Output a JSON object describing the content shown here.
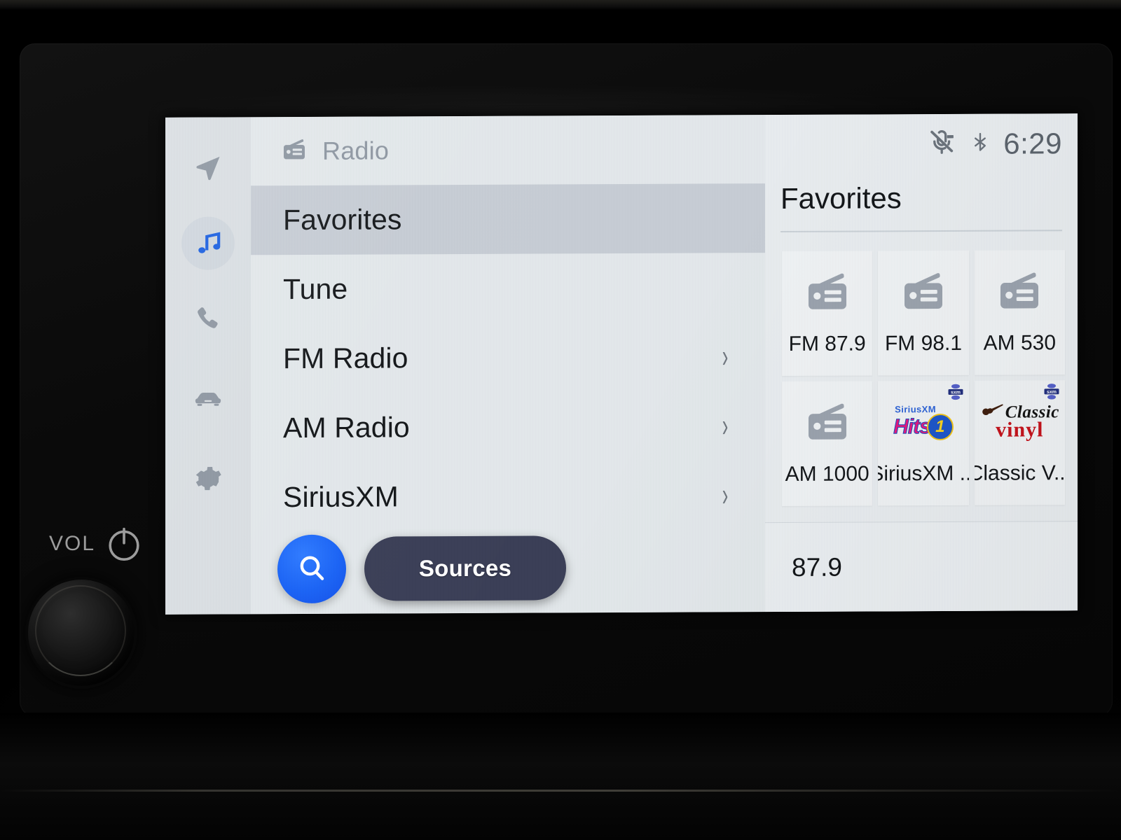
{
  "hardware": {
    "vol_label": "VOL",
    "power_icon": "power-icon",
    "knob": "volume-knob"
  },
  "sidebar": {
    "items": [
      {
        "icon": "navigation-arrow-icon",
        "name": "navigation",
        "active": false
      },
      {
        "icon": "music-note-icon",
        "name": "media",
        "active": true
      },
      {
        "icon": "phone-icon",
        "name": "phone",
        "active": false
      },
      {
        "icon": "car-icon",
        "name": "vehicle",
        "active": false
      },
      {
        "icon": "gear-icon",
        "name": "settings",
        "active": false
      }
    ]
  },
  "list_panel": {
    "header": {
      "icon": "radio-icon",
      "label": "Radio"
    },
    "rows": [
      {
        "label": "Favorites",
        "selected": true,
        "chevron": false
      },
      {
        "label": "Tune",
        "selected": false,
        "chevron": false
      },
      {
        "label": "FM Radio",
        "selected": false,
        "chevron": true,
        "chevron_glyph": "›"
      },
      {
        "label": "AM Radio",
        "selected": false,
        "chevron": true,
        "chevron_glyph": "›"
      },
      {
        "label": "SiriusXM",
        "selected": false,
        "chevron": true,
        "chevron_glyph": "›"
      }
    ],
    "actions": {
      "search_icon": "search-icon",
      "sources_label": "Sources"
    }
  },
  "right_panel": {
    "status": {
      "mic_muted_icon": "microphone-muted-icon",
      "bluetooth_icon": "bluetooth-icon",
      "bluetooth_glyph": "✳",
      "time": "6:29"
    },
    "title": "Favorites",
    "favorites": [
      {
        "label": "FM 87.9",
        "art": "radio-icon",
        "sxm_badge": false
      },
      {
        "label": "FM 98.1",
        "art": "radio-icon",
        "sxm_badge": false
      },
      {
        "label": "AM 530",
        "art": "radio-icon",
        "sxm_badge": false
      },
      {
        "label": "AM 1000",
        "art": "radio-icon",
        "sxm_badge": false
      },
      {
        "label": "SiriusXM ...",
        "art": "siriusxm-hits1-logo",
        "sxm_badge": true,
        "logo_text": {
          "top": "SiriusXM",
          "word": "Hits",
          "number": "1"
        }
      },
      {
        "label": "Classic V...",
        "art": "classic-vinyl-logo",
        "sxm_badge": true,
        "logo_text": {
          "classic": "Classic",
          "vinyl": "vinyl"
        }
      }
    ],
    "now_playing": {
      "frequency": "87.9"
    }
  },
  "colors": {
    "accent_blue": "#1a63f5",
    "sources_navy": "#3b3f57",
    "screen_bg": "#dfe4e7",
    "selected_row": "#c6ccd4",
    "tile_bg": "#eef1f3",
    "icon_gray": "#8d96a1"
  }
}
